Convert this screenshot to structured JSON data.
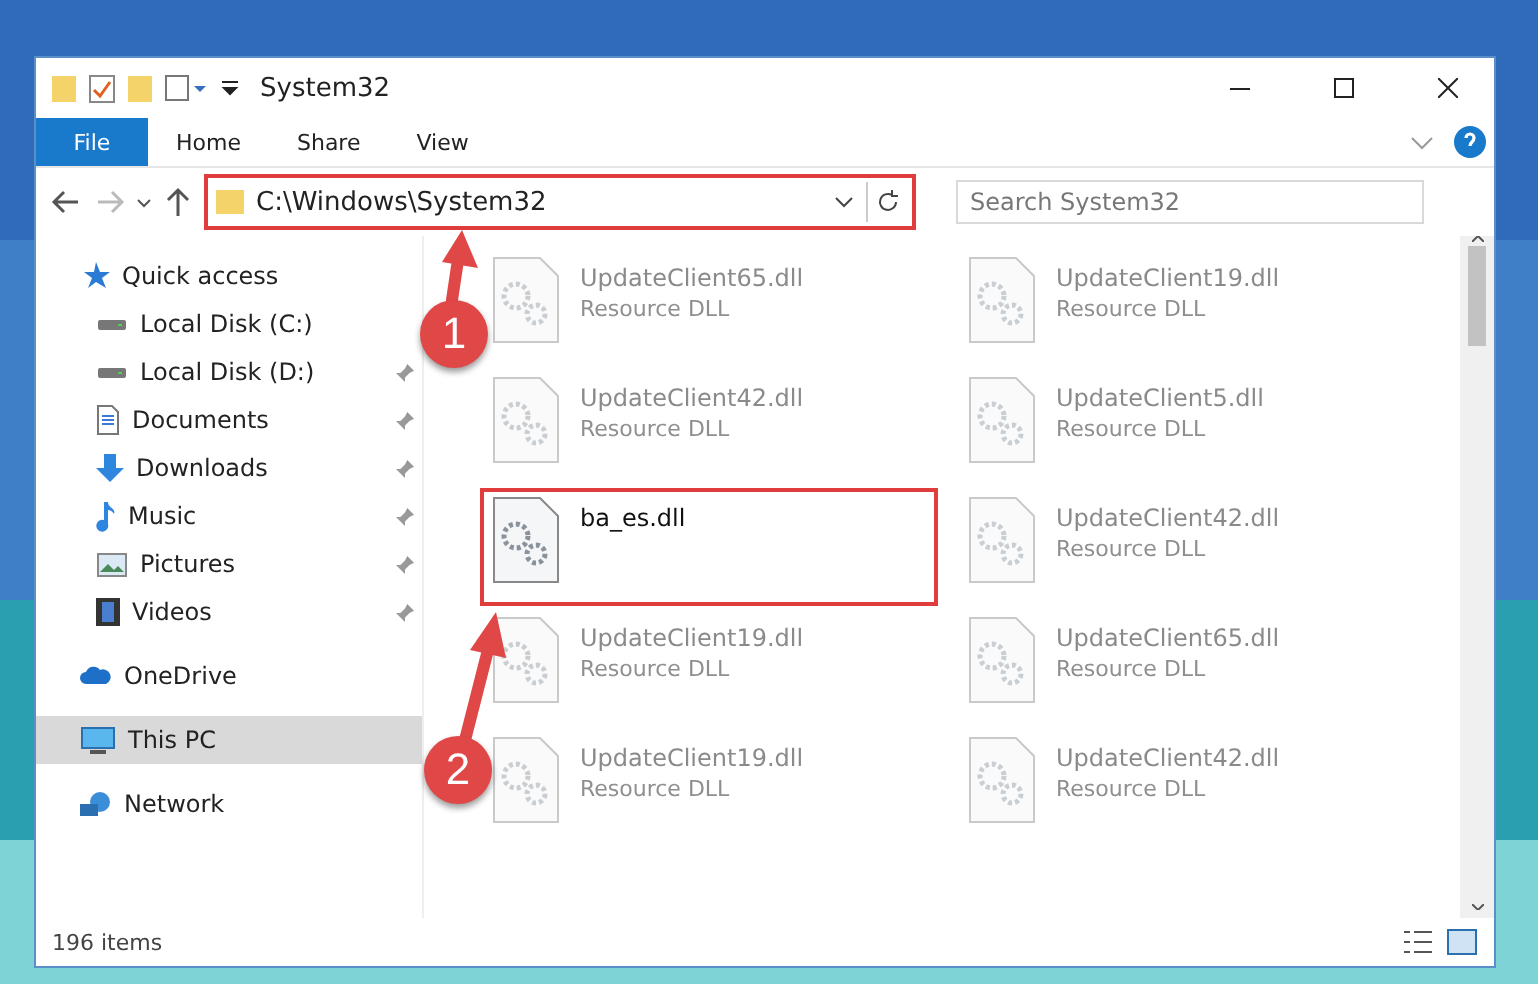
{
  "window": {
    "title": "System32"
  },
  "ribbon_tabs": [
    {
      "label": "File",
      "kind": "menu"
    },
    {
      "label": "Home",
      "kind": "tab"
    },
    {
      "label": "Share",
      "kind": "tab"
    },
    {
      "label": "View",
      "kind": "tab"
    }
  ],
  "address_bar": {
    "path": "C:\\Windows\\System32",
    "highlighted": true
  },
  "search": {
    "placeholder": "Search System32"
  },
  "sidebar": {
    "items": [
      {
        "label": "Quick access",
        "kind": "star",
        "selected": false,
        "children": [
          {
            "label": "Local Disk (C:)",
            "kind": "drive",
            "pinned": false,
            "selected": false
          },
          {
            "label": "Local Disk (D:)",
            "kind": "drive",
            "pinned": true,
            "selected": false
          },
          {
            "label": "Documents",
            "kind": "document",
            "pinned": true,
            "selected": false
          },
          {
            "label": "Downloads",
            "kind": "download",
            "pinned": true,
            "selected": false
          },
          {
            "label": "Music",
            "kind": "music",
            "pinned": true,
            "selected": false
          },
          {
            "label": "Pictures",
            "kind": "pictures",
            "pinned": true,
            "selected": false
          },
          {
            "label": "Videos",
            "kind": "videos",
            "pinned": true,
            "selected": false
          }
        ]
      },
      {
        "label": "OneDrive",
        "kind": "cloud",
        "selected": false
      },
      {
        "label": "This PC",
        "kind": "computer",
        "selected": true
      },
      {
        "label": "Network",
        "kind": "network",
        "selected": false
      }
    ]
  },
  "files": [
    {
      "name": "UpdateClient65.dll",
      "type": "Resource DLL",
      "blurred": true,
      "highlighted": false
    },
    {
      "name": "UpdateClient19.dll",
      "type": "Resource DLL",
      "blurred": true,
      "highlighted": false
    },
    {
      "name": "UpdateClient42.dll",
      "type": "Resource DLL",
      "blurred": true,
      "highlighted": false
    },
    {
      "name": "UpdateClient5.dll",
      "type": "Resource DLL",
      "blurred": true,
      "highlighted": false
    },
    {
      "name": "ba_es.dll",
      "blurred": false,
      "highlighted": true
    },
    {
      "name": "UpdateClient42.dll",
      "type": "Resource DLL",
      "blurred": true,
      "highlighted": false
    },
    {
      "name": "UpdateClient19.dll",
      "type": "Resource DLL",
      "blurred": true,
      "highlighted": false
    },
    {
      "name": "UpdateClient65.dll",
      "type": "Resource DLL",
      "blurred": true,
      "highlighted": false
    },
    {
      "name": "UpdateClient19.dll",
      "type": "Resource DLL",
      "blurred": true,
      "highlighted": false
    },
    {
      "name": "UpdateClient42.dll",
      "type": "Resource DLL",
      "blurred": true,
      "highlighted": false
    }
  ],
  "status_bar": {
    "item_count": "196 items"
  },
  "annotations": [
    {
      "number": "1"
    },
    {
      "number": "2"
    }
  ]
}
